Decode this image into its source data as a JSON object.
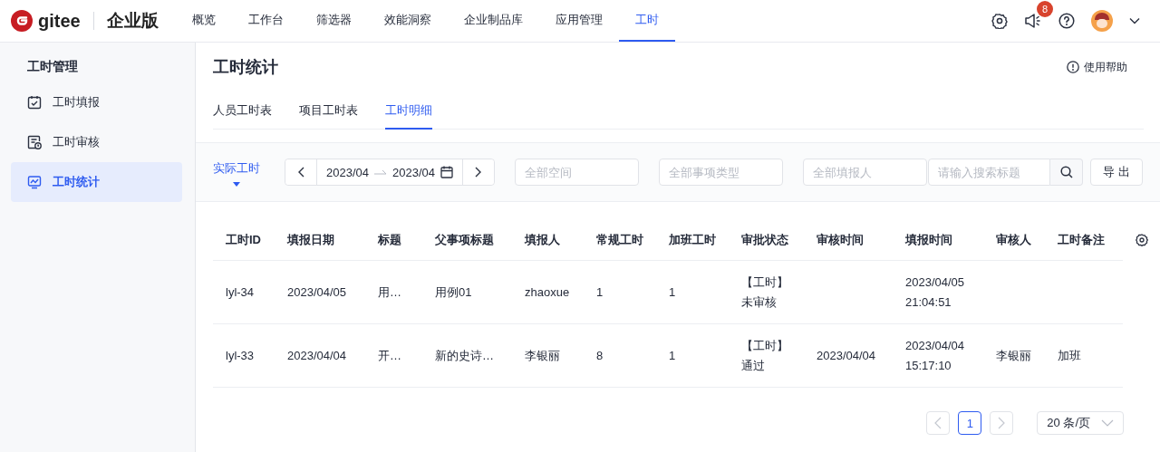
{
  "nav": {
    "brand": "gitee",
    "edition": "企业版",
    "items": [
      {
        "label": "概览",
        "selected": false
      },
      {
        "label": "工作台",
        "selected": false
      },
      {
        "label": "筛选器",
        "selected": false
      },
      {
        "label": "效能洞察",
        "selected": false
      },
      {
        "label": "企业制品库",
        "selected": false
      },
      {
        "label": "应用管理",
        "selected": false
      },
      {
        "label": "工时",
        "selected": true
      }
    ],
    "notification_count": "8"
  },
  "sidebar": {
    "title": "工时管理",
    "items": [
      {
        "label": "工时填报",
        "kind": "checklist",
        "selected": false
      },
      {
        "label": "工时审核",
        "kind": "review",
        "selected": false
      },
      {
        "label": "工时统计",
        "kind": "monitor",
        "selected": true
      }
    ]
  },
  "page": {
    "title": "工时统计",
    "help": "使用帮助",
    "tabs": [
      {
        "label": "人员工时表",
        "selected": false
      },
      {
        "label": "项目工时表",
        "selected": false
      },
      {
        "label": "工时明细",
        "selected": true
      }
    ]
  },
  "filters": {
    "mode": "实际工时",
    "date_start": "2023/04",
    "date_end": "2023/04",
    "selects": [
      {
        "placeholder": "全部空间"
      },
      {
        "placeholder": "全部事项类型"
      },
      {
        "placeholder": "全部填报人"
      }
    ],
    "search": {
      "placeholder": "请输入搜索标题"
    },
    "export": "导 出"
  },
  "table": {
    "columns": [
      "工时ID",
      "填报日期",
      "标题",
      "父事项标题",
      "填报人",
      "常规工时",
      "加班工时",
      "审批状态",
      "审核时间",
      "填报时间",
      "审核人",
      "工时备注"
    ],
    "rows": [
      [
        "lyl-34",
        "2023/04/05",
        "用…",
        "用例01",
        "zhaoxue",
        "1",
        "1",
        "【工时】未审核",
        "",
        "2023/04/05\n21:04:51",
        "",
        ""
      ],
      [
        "lyl-33",
        "2023/04/04",
        "开…",
        "新的史诗…",
        "李银丽",
        "8",
        "1",
        "【工时】通过",
        "2023/04/04",
        "2023/04/04\n15:17:10",
        "李银丽",
        "加班"
      ]
    ]
  },
  "pagination": {
    "pages": [
      {
        "label": "1",
        "selected": true
      }
    ],
    "page_size": "20 条/页"
  }
}
